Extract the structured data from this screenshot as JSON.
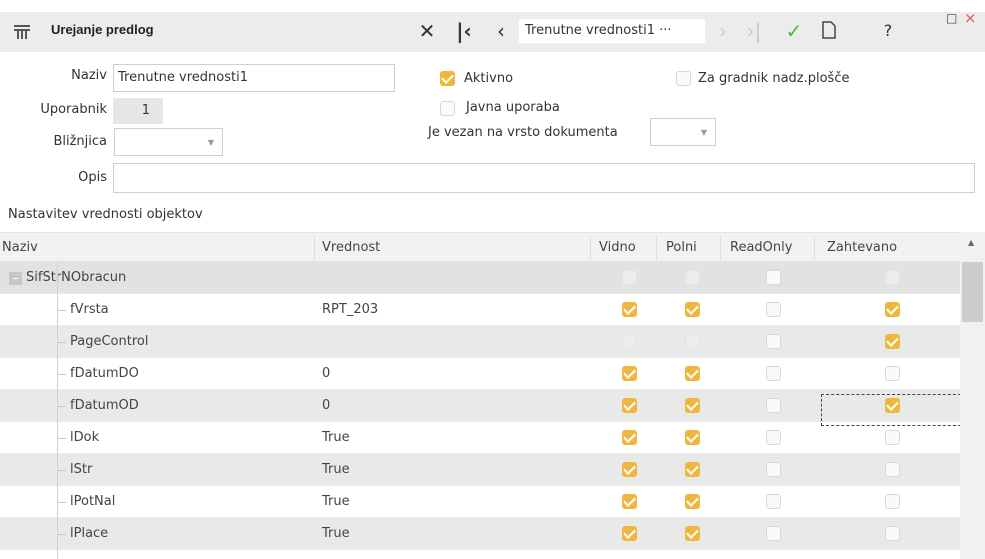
{
  "window": {
    "title": "Urejanje predlog",
    "record_selector": "Trenutne vrednosti1 ···",
    "toolbar_icons": [
      "close-x-icon",
      "first-record-icon",
      "previous-record-icon",
      "next-record-icon",
      "last-record-icon",
      "confirm-check-icon",
      "new-document-icon"
    ],
    "help_label": "?",
    "maximize_glyph": "□",
    "close_glyph": "×"
  },
  "form": {
    "naziv_label": "Naziv",
    "naziv_value": "Trenutne vrednosti1",
    "uporabnik_label": "Uporabnik",
    "uporabnik_value": "1",
    "bliznjica_label": "Bližnjica",
    "bliznjica_value": "",
    "opis_label": "Opis",
    "opis_value": "",
    "aktivno_label": "Aktivno",
    "aktivno_checked": true,
    "javna_label": "Javna uporaba",
    "javna_checked": false,
    "gradnik_label": "Za gradnik nadz.plošče",
    "gradnik_checked": false,
    "vezan_label": "Je vezan na vrsto dokumenta",
    "vezan_value": ""
  },
  "grid": {
    "section_title": "Nastavitev vrednosti objektov",
    "columns": {
      "naziv": "Naziv",
      "vrednost": "Vrednost",
      "vidno": "Vidno",
      "polni": "Polni",
      "readonly": "ReadOnly",
      "zahtevano": "Zahtevano"
    },
    "rows": [
      {
        "name": "SifStrNObracun",
        "value": "",
        "vidno": false,
        "polni": false,
        "readonly": false,
        "zahtevano": false,
        "parent": true
      },
      {
        "name": "fVrsta",
        "value": "RPT_203",
        "vidno": true,
        "polni": true,
        "readonly": false,
        "zahtevano": true
      },
      {
        "name": "PageControl",
        "value": "",
        "vidno": false,
        "polni": false,
        "readonly": false,
        "zahtevano": true
      },
      {
        "name": "fDatumDO",
        "value": "0",
        "vidno": true,
        "polni": true,
        "readonly": false,
        "zahtevano": false
      },
      {
        "name": "fDatumOD",
        "value": "0",
        "vidno": true,
        "polni": true,
        "readonly": false,
        "zahtevano": true,
        "focused": true
      },
      {
        "name": "lDok",
        "value": "True",
        "vidno": true,
        "polni": true,
        "readonly": false,
        "zahtevano": false
      },
      {
        "name": "lStr",
        "value": "True",
        "vidno": true,
        "polni": true,
        "readonly": false,
        "zahtevano": false
      },
      {
        "name": "lPotNal",
        "value": "True",
        "vidno": true,
        "polni": true,
        "readonly": false,
        "zahtevano": false
      },
      {
        "name": "lPlace",
        "value": "True",
        "vidno": true,
        "polni": true,
        "readonly": false,
        "zahtevano": false
      }
    ]
  },
  "colors": {
    "checkbox_checked": "#f0b73d",
    "confirm_green": "#5cb82b",
    "close_red": "#e05a5a"
  }
}
